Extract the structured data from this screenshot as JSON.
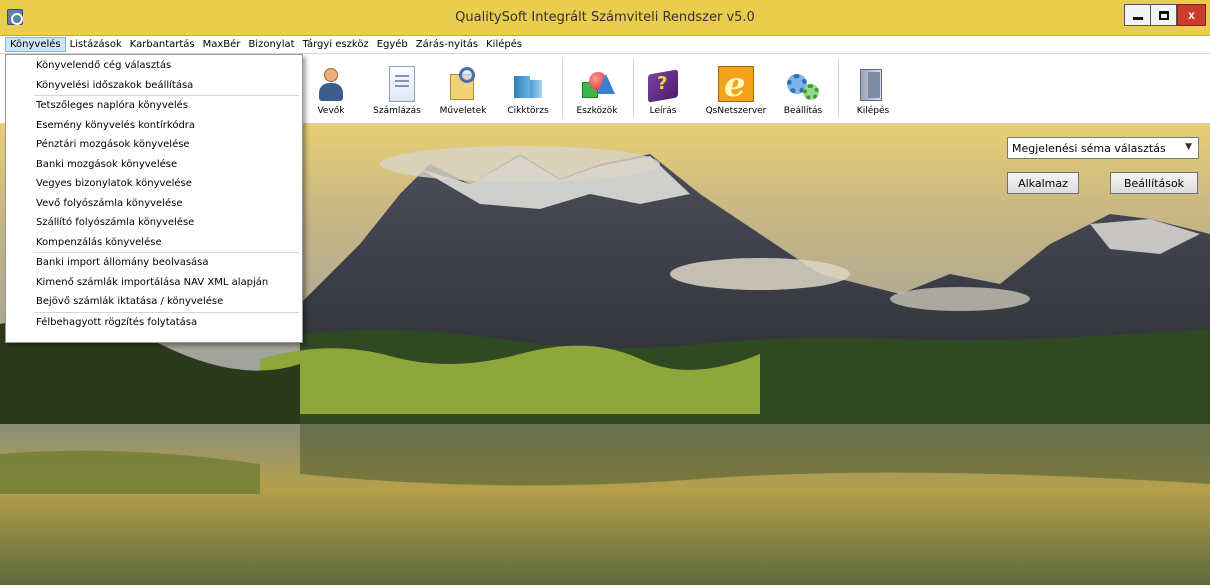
{
  "window": {
    "title": "QualitySoft Integrált Számviteli Rendszer  v5.0",
    "close_glyph": "x"
  },
  "menubar": {
    "items": [
      {
        "label": "Könyvelés",
        "active": true
      },
      {
        "label": "Listázások"
      },
      {
        "label": "Karbantartás"
      },
      {
        "label": "MaxBér"
      },
      {
        "label": "Bizonylat"
      },
      {
        "label": "Tárgyi eszköz"
      },
      {
        "label": "Egyéb"
      },
      {
        "label": "Zárás-nyitás"
      },
      {
        "label": "Kilépés"
      }
    ]
  },
  "toolbar": {
    "buttons": [
      {
        "label": "Vevők",
        "icon": "user-icon"
      },
      {
        "label": "Számlázás",
        "icon": "document-icon"
      },
      {
        "label": "Műveletek",
        "icon": "search-folder-icon"
      },
      {
        "label": "Cikktörzs",
        "icon": "cubes-icon"
      },
      {
        "label": "Eszközök",
        "icon": "shapes-icon"
      },
      {
        "label": "Leírás",
        "icon": "help-book-icon"
      },
      {
        "label": "QsNetszerver",
        "icon": "browser-icon"
      },
      {
        "label": "Beállítás",
        "icon": "gears-icon"
      },
      {
        "label": "Kilépés",
        "icon": "exit-door-icon"
      }
    ]
  },
  "dropdown": {
    "groups": [
      [
        "Könyvelendő cég választás",
        "Könyvelési időszakok beállítása"
      ],
      [
        "Tetszőleges naplóra könyvelés",
        "Esemény könyvelés kontírkódra",
        "Pénztári mozgások könyvelése",
        "Banki mozgások könyvelése",
        "Vegyes bizonylatok könyvelése",
        "Vevő folyószámla könyvelése",
        "Szállító folyószámla könyvelése",
        "Kompenzálás könyvelése"
      ],
      [
        "Banki import állomány beolvasása",
        "Kimenő számlák importálása NAV XML alapján",
        "Bejövő számlák iktatása / könyvelése"
      ],
      [
        "Félbehagyott rögzítés folytatása"
      ]
    ]
  },
  "right_panel": {
    "scheme_select": "Megjelenési séma választás",
    "apply_button": "Alkalmaz",
    "settings_button": "Beállítások"
  },
  "colors": {
    "titlebar": "#ebcd4d",
    "close_button": "#c93b2b",
    "menu_highlight": "#cce4f7"
  }
}
